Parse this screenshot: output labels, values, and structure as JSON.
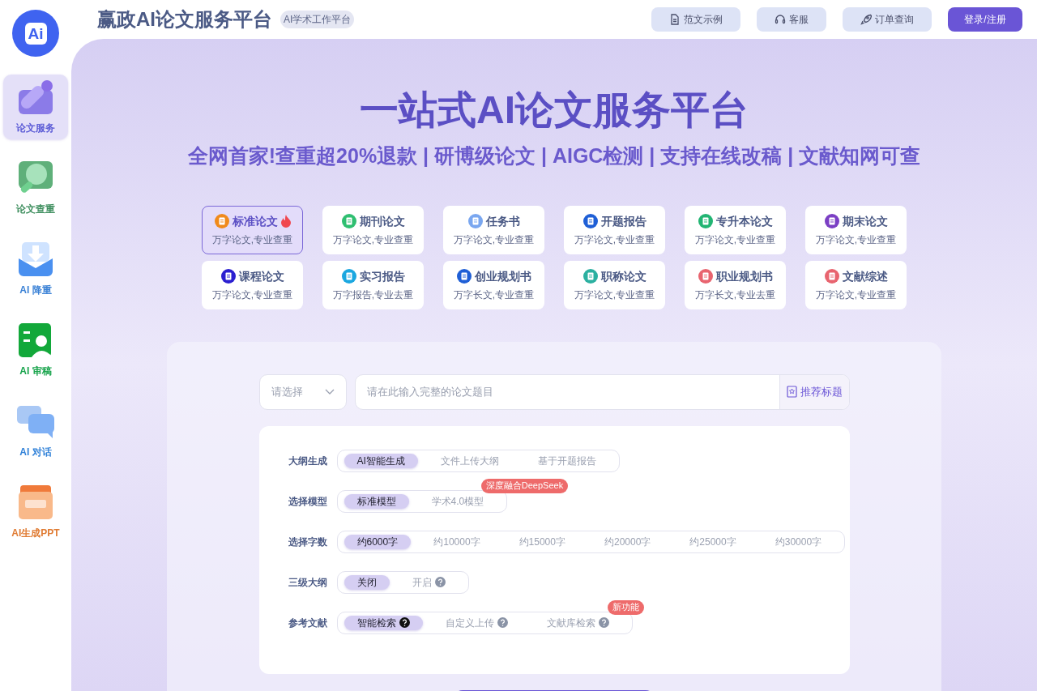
{
  "logo": {
    "text": "Ai"
  },
  "header": {
    "title": "赢政AI论文服务平台",
    "badge": "AI学术工作平台",
    "buttons": [
      {
        "label": "范文示例",
        "kind": "secondary"
      },
      {
        "label": "客服",
        "kind": "secondary"
      },
      {
        "label": "订单查询",
        "kind": "secondary"
      },
      {
        "label": "登录/注册",
        "kind": "primary"
      }
    ]
  },
  "sidebar": {
    "items": [
      {
        "label": "论文服务",
        "selected": true,
        "color": "#5b5bd6"
      },
      {
        "label": "论文查重",
        "selected": false,
        "color": "#3f8f5f"
      },
      {
        "label": "AI 降重",
        "selected": false,
        "color": "#3b82d6"
      },
      {
        "label": "AI 审稿",
        "selected": false,
        "color": "#16a34a"
      },
      {
        "label": "AI 对话",
        "selected": false,
        "color": "#2f80d8"
      },
      {
        "label": "AI生成PPT",
        "selected": false,
        "color": "#e07b32"
      }
    ]
  },
  "hero": {
    "title": "一站式AI论文服务平台",
    "subtitle": "全网首家!查重超20%退款 | 研博级论文 | AIGC检测 | 支持在线改稿 | 文献知网可查"
  },
  "services": [
    {
      "title": "标准论文",
      "desc": "万字论文,专业查重",
      "color": "#f08a1c",
      "selected": true,
      "hot": true
    },
    {
      "title": "期刊论文",
      "desc": "万字论文,专业查重",
      "color": "#2fbf71",
      "selected": false,
      "hot": false
    },
    {
      "title": "任务书",
      "desc": "万字论文,专业查重",
      "color": "#7aa7f0",
      "selected": false,
      "hot": false
    },
    {
      "title": "开题报告",
      "desc": "万字论文,专业查重",
      "color": "#1f5fd6",
      "selected": false,
      "hot": false
    },
    {
      "title": "专升本论文",
      "desc": "万字论文,专业查重",
      "color": "#22b573",
      "selected": false,
      "hot": false
    },
    {
      "title": "期末论文",
      "desc": "万字论文,专业查重",
      "color": "#7b3fc4",
      "selected": false,
      "hot": false
    },
    {
      "title": "课程论文",
      "desc": "万字论文,专业查重",
      "color": "#2b1fd0",
      "selected": false,
      "hot": false
    },
    {
      "title": "实习报告",
      "desc": "万字报告,专业去重",
      "color": "#1aa7e0",
      "selected": false,
      "hot": false
    },
    {
      "title": "创业规划书",
      "desc": "万字长文,专业查重",
      "color": "#1f5fd6",
      "selected": false,
      "hot": false
    },
    {
      "title": "职称论文",
      "desc": "万字论文,专业查重",
      "color": "#2bb0a0",
      "selected": false,
      "hot": false
    },
    {
      "title": "职业规划书",
      "desc": "万字长文,专业去重",
      "color": "#e8646f",
      "selected": false,
      "hot": false
    },
    {
      "title": "文献综述",
      "desc": "万字论文,专业查重",
      "color": "#e8646f",
      "selected": false,
      "hot": false
    }
  ],
  "form": {
    "select": {
      "placeholder": "请选择"
    },
    "topic": {
      "placeholder": "请在此输入完整的论文题目"
    },
    "recommend": "推荐标题",
    "rows": [
      {
        "label": "大纲生成",
        "options": [
          {
            "label": "AI智能生成",
            "selected": true,
            "help": false
          },
          {
            "label": "文件上传大纲",
            "selected": false,
            "help": false
          },
          {
            "label": "基于开题报告",
            "selected": false,
            "help": false
          }
        ]
      },
      {
        "label": "选择模型",
        "badge": "深度融合DeepSeek",
        "options": [
          {
            "label": "标准模型",
            "selected": true,
            "help": false
          },
          {
            "label": "学术4.0模型",
            "selected": false,
            "help": false
          }
        ]
      },
      {
        "label": "选择字数",
        "options": [
          {
            "label": "约6000字",
            "selected": true,
            "help": false
          },
          {
            "label": "约10000字",
            "selected": false,
            "help": false
          },
          {
            "label": "约15000字",
            "selected": false,
            "help": false
          },
          {
            "label": "约20000字",
            "selected": false,
            "help": false
          },
          {
            "label": "约25000字",
            "selected": false,
            "help": false
          },
          {
            "label": "约30000字",
            "selected": false,
            "help": false
          }
        ]
      },
      {
        "label": "三级大纲",
        "options": [
          {
            "label": "关闭",
            "selected": true,
            "help": false
          },
          {
            "label": "开启",
            "selected": false,
            "help": true
          }
        ]
      },
      {
        "label": "参考文献",
        "badge": "新功能",
        "options": [
          {
            "label": "智能检索",
            "selected": true,
            "help": true
          },
          {
            "label": "自定义上传",
            "selected": false,
            "help": true
          },
          {
            "label": "文献库检索",
            "selected": false,
            "help": true
          }
        ]
      }
    ]
  }
}
